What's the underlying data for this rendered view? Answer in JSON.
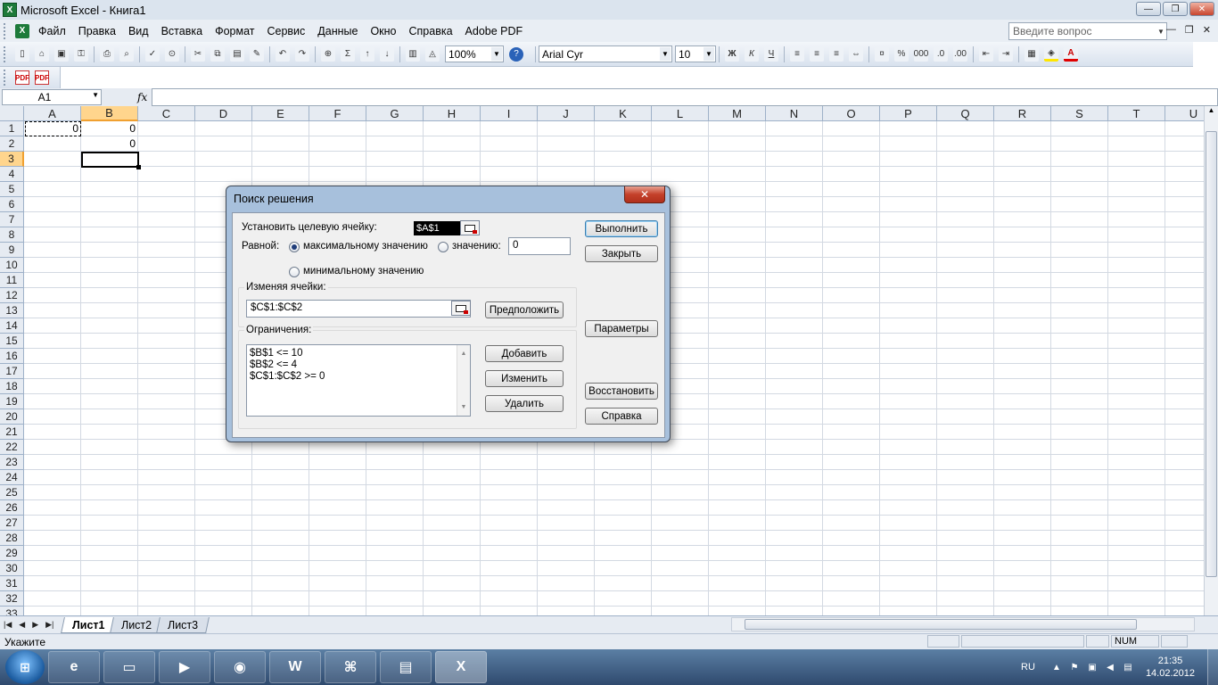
{
  "window": {
    "title": "Microsoft Excel - Книга1",
    "app_icon": "excel-icon"
  },
  "menu": {
    "items": [
      "Файл",
      "Правка",
      "Вид",
      "Вставка",
      "Формат",
      "Сервис",
      "Данные",
      "Окно",
      "Справка",
      "Adobe PDF"
    ],
    "ask_placeholder": "Введите вопрос"
  },
  "toolbar": {
    "zoom": "100%",
    "font": "Arial Cyr",
    "font_size": "10"
  },
  "formula_bar": {
    "name_box": "A1",
    "fx": "fx",
    "value": ""
  },
  "sheet": {
    "columns": [
      "A",
      "B",
      "C",
      "D",
      "E",
      "F",
      "G",
      "H",
      "I",
      "J",
      "K",
      "L",
      "M",
      "N",
      "O",
      "P",
      "Q",
      "R",
      "S",
      "T",
      "U"
    ],
    "rows": [
      "1",
      "2",
      "3",
      "4",
      "5",
      "6",
      "7",
      "8",
      "9",
      "10",
      "11",
      "12",
      "13",
      "14",
      "15",
      "16",
      "17",
      "18",
      "19",
      "20",
      "21",
      "22",
      "23",
      "24",
      "25",
      "26",
      "27",
      "28",
      "29",
      "30",
      "31",
      "32",
      "33"
    ],
    "cells": {
      "A1": "0",
      "B1": "0",
      "B2": "0"
    },
    "active_cell": "B3",
    "tabs": [
      "Лист1",
      "Лист2",
      "Лист3"
    ],
    "active_tab": "Лист1"
  },
  "status": {
    "mode": "Укажите",
    "num": "NUM"
  },
  "dialog": {
    "title": "Поиск решения",
    "close": "✕",
    "target_label": "Установить целевую ячейку:",
    "target_ref": "$A$1",
    "equal_label": "Равной:",
    "opt_max": "максимальному значению",
    "opt_value": "значению:",
    "value_input": "0",
    "opt_min": "минимальному значению",
    "selected_option": "max",
    "changing_label": "Изменяя ячейки:",
    "changing_ref": "$C$1:$C$2",
    "guess_btn": "Предположить",
    "constraints_label": "Ограничения:",
    "constraints": [
      "$B$1 <= 10",
      "$B$2 <= 4",
      "$C$1:$C$2 >= 0"
    ],
    "add_btn": "Добавить",
    "change_btn": "Изменить",
    "delete_btn": "Удалить",
    "solve_btn": "Выполнить",
    "close_btn": "Закрыть",
    "options_btn": "Параметры",
    "reset_btn": "Восстановить",
    "help_btn": "Справка"
  },
  "taskbar": {
    "items": [
      {
        "name": "internet-explorer-icon",
        "glyph": "e"
      },
      {
        "name": "file-explorer-icon",
        "glyph": "▭"
      },
      {
        "name": "media-player-icon",
        "glyph": "▶"
      },
      {
        "name": "firefox-icon",
        "glyph": "◉"
      },
      {
        "name": "word-icon",
        "glyph": "W"
      },
      {
        "name": "acrobat-icon",
        "glyph": "⌘"
      },
      {
        "name": "winrar-icon",
        "glyph": "▤"
      },
      {
        "name": "excel-icon",
        "glyph": "X"
      }
    ],
    "lang": "RU",
    "time": "21:35",
    "date": "14.02.2012"
  },
  "colors": {
    "accent": "#ffd58d",
    "titlebar": "#dbe4ee",
    "dialog_frame": "#a7c0dc",
    "close": "#c4402a"
  }
}
